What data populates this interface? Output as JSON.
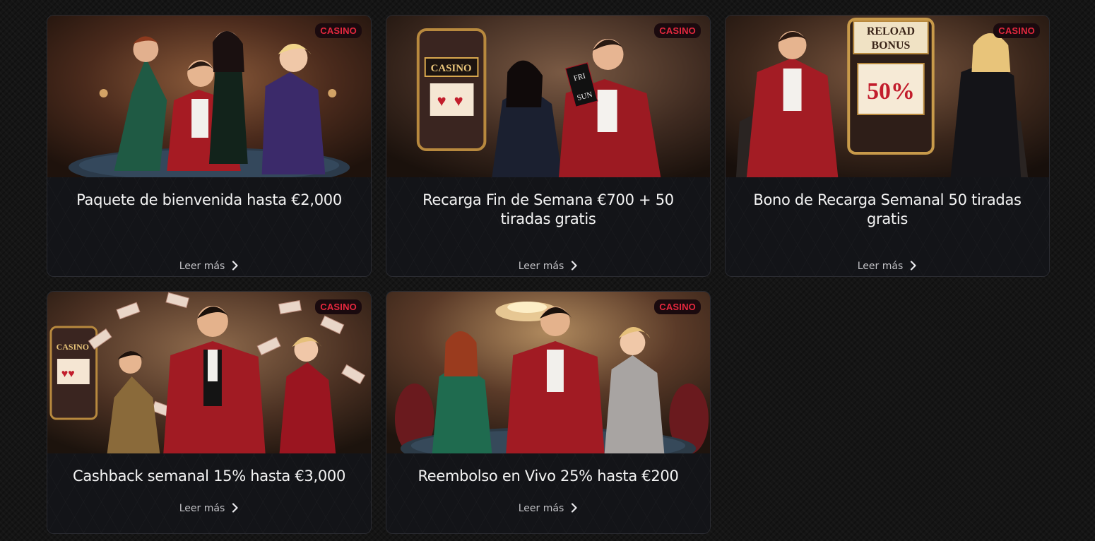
{
  "colors": {
    "page_background": "#151515",
    "card_background": "#131418",
    "badge_text": "#e5283f",
    "title_text": "#f3f3f3",
    "link_text": "#c2c2c6"
  },
  "promotions": [
    {
      "badge": "CASINO",
      "title": "Paquete de bienvenida hasta €2,000",
      "link_label": "Leer más",
      "link_icon": "chevron-right-icon"
    },
    {
      "badge": "CASINO",
      "title": "Recarga Fin de Semana €700 + 50 tiradas gratis",
      "link_label": "Leer más",
      "link_icon": "chevron-right-icon",
      "image_text": [
        "CASINO",
        "FRI",
        "SUN"
      ]
    },
    {
      "badge": "CASINO",
      "title": "Bono de Recarga Semanal 50 tiradas gratis",
      "link_label": "Leer más",
      "link_icon": "chevron-right-icon",
      "image_text": [
        "RELOAD",
        "BONUS",
        "50%"
      ]
    },
    {
      "badge": "CASINO",
      "title": "Cashback semanal 15% hasta €3,000",
      "link_label": "Leer más",
      "link_icon": "chevron-right-icon",
      "image_text": [
        "CASINO"
      ]
    },
    {
      "badge": "CASINO",
      "title": "Reembolso en Vivo 25% hasta €200",
      "link_label": "Leer más",
      "link_icon": "chevron-right-icon"
    }
  ]
}
